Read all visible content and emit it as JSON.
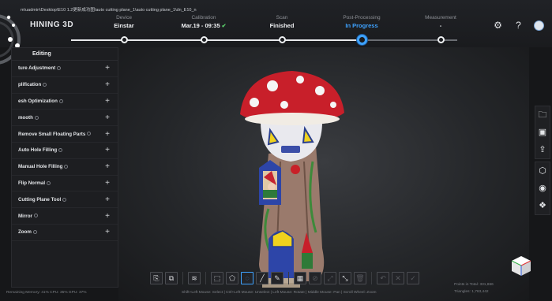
{
  "header": {
    "path": "m\\uadmin\\Desktop\\E10 1.2更新成功图\\auto cutting plane_1\\auto cutting plane_1\\dn_E10_n",
    "logo": "HINING 3D",
    "stages": [
      {
        "label": "Device",
        "value": "Einstar",
        "state": "done"
      },
      {
        "label": "Calibration",
        "value": "Mar.19 - 09:35",
        "state": "done",
        "check": "✔"
      },
      {
        "label": "Scan",
        "value": "Finished",
        "state": "done"
      },
      {
        "label": "Post-Processing",
        "value": "In Progress",
        "state": "active"
      },
      {
        "label": "Measurement",
        "value": "-",
        "state": "pending"
      }
    ],
    "icons": [
      "settings-gear-icon",
      "help-icon",
      "user-avatar-icon"
    ]
  },
  "panel": {
    "title": "Editing",
    "items": [
      {
        "label": "ture Adjustment"
      },
      {
        "label": "plification"
      },
      {
        "label": "esh Optimization"
      },
      {
        "label": "mooth"
      },
      {
        "label": "Remove Small Floating Parts"
      },
      {
        "label": "Auto Hole Filling"
      },
      {
        "label": "Manual Hole Filling"
      },
      {
        "label": "Flip Normal"
      },
      {
        "label": "Cutting Plane Tool"
      },
      {
        "label": "Mirror"
      },
      {
        "label": "Zoom"
      }
    ]
  },
  "right_toolbar": {
    "group1": [
      "folder-icon",
      "save-icon",
      "export-icon"
    ],
    "group2": [
      "mesh-icon",
      "eye-icon",
      "texture-icon"
    ]
  },
  "bottom_toolbar": {
    "group1": [
      "import-icon",
      "copy-icon"
    ],
    "group2": [
      "layers-icon"
    ],
    "group3": [
      "rect-select-icon",
      "polygon-select-icon",
      "lasso-select-icon",
      "line-select-icon",
      "brush-select-icon"
    ],
    "group4": [
      "select-all-icon",
      "invert-select-icon",
      "expand-select-icon",
      "shrink-select-icon",
      "delete-icon"
    ],
    "group5": [
      "undo-icon",
      "cancel-icon",
      "confirm-icon"
    ]
  },
  "status": {
    "left": "Remaining Memory: 41% CPU: 35% GPU: 37%",
    "middle": "Shift+Left Mouse: Select | Ctrl+Left Mouse: Unselect | Left Mouse: Rotate | Middle Mouse: Pan | Scroll Wheel: Zoom",
    "points": "Points in Total: 331,866",
    "triangles": "Triangles: 1,763,442"
  },
  "colors": {
    "accent": "#3ea2ff",
    "background": "#161719",
    "panel": "#1d1e21"
  }
}
